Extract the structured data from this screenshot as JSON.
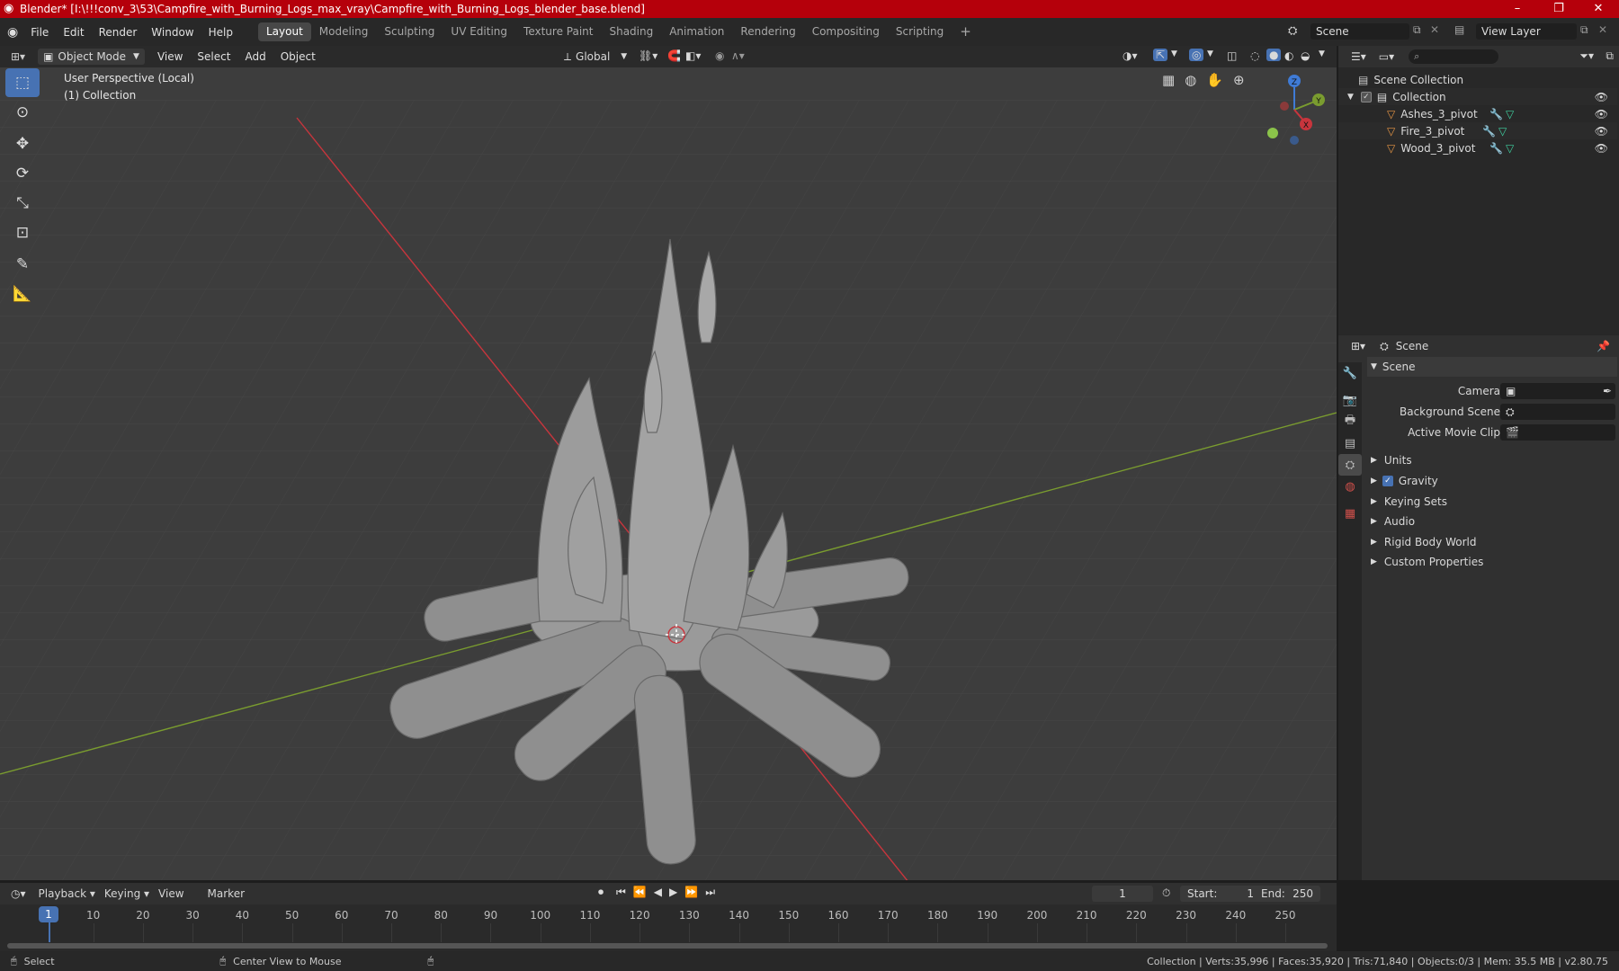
{
  "window": {
    "title": "Blender* [I:\\!!!conv_3\\53\\Campfire_with_Burning_Logs_max_vray\\Campfire_with_Burning_Logs_blender_base.blend]",
    "minimize": "–",
    "maximize": "❐",
    "close": "✕"
  },
  "menu": {
    "items": [
      "File",
      "Edit",
      "Render",
      "Window",
      "Help"
    ]
  },
  "workspaces": [
    "Layout",
    "Modeling",
    "Sculpting",
    "UV Editing",
    "Texture Paint",
    "Shading",
    "Animation",
    "Rendering",
    "Compositing",
    "Scripting"
  ],
  "workspace_add": "+",
  "scene_field": "Scene",
  "view_layer_field": "View Layer",
  "viewport": {
    "mode": "Object Mode",
    "menus": [
      "View",
      "Select",
      "Add",
      "Object"
    ],
    "orientation": "Global",
    "overlay_line1": "User Perspective (Local)",
    "overlay_line2": "(1) Collection",
    "gizmo": {
      "z": "Z",
      "y": "Y",
      "x": "X"
    }
  },
  "outliner": {
    "root": "Scene Collection",
    "collection": "Collection",
    "items": [
      "Ashes_3_pivot",
      "Fire_3_pivot",
      "Wood_3_pivot"
    ]
  },
  "properties": {
    "header": "Scene",
    "section": "Scene",
    "fields": [
      {
        "label": "Camera"
      },
      {
        "label": "Background Scene"
      },
      {
        "label": "Active Movie Clip"
      }
    ],
    "panels": [
      "Units",
      "Gravity",
      "Keying Sets",
      "Audio",
      "Rigid Body World",
      "Custom Properties"
    ]
  },
  "timeline": {
    "menus": [
      "Playback",
      "Keying",
      "View",
      "Marker"
    ],
    "current_frame": "1",
    "start_label": "Start:",
    "start": "1",
    "end_label": "End:",
    "end": "250",
    "ticks": [
      "1",
      "10",
      "20",
      "30",
      "40",
      "50",
      "60",
      "70",
      "80",
      "90",
      "100",
      "110",
      "120",
      "130",
      "140",
      "150",
      "160",
      "170",
      "180",
      "190",
      "200",
      "210",
      "220",
      "230",
      "240",
      "250"
    ]
  },
  "statusbar": {
    "select": "Select",
    "center": "Center View to Mouse",
    "stats": "Collection | Verts:35,996 | Faces:35,920 | Tris:71,840 | Objects:0/3 | Mem: 35.5 MB | v2.80.75"
  },
  "colors": {
    "accent": "#4772b3",
    "titlebar": "#b5000b",
    "x_axis": "#c8353d",
    "y_axis": "#7a9c2f",
    "object": "#e69544",
    "mesh": "#3fd0a0"
  }
}
